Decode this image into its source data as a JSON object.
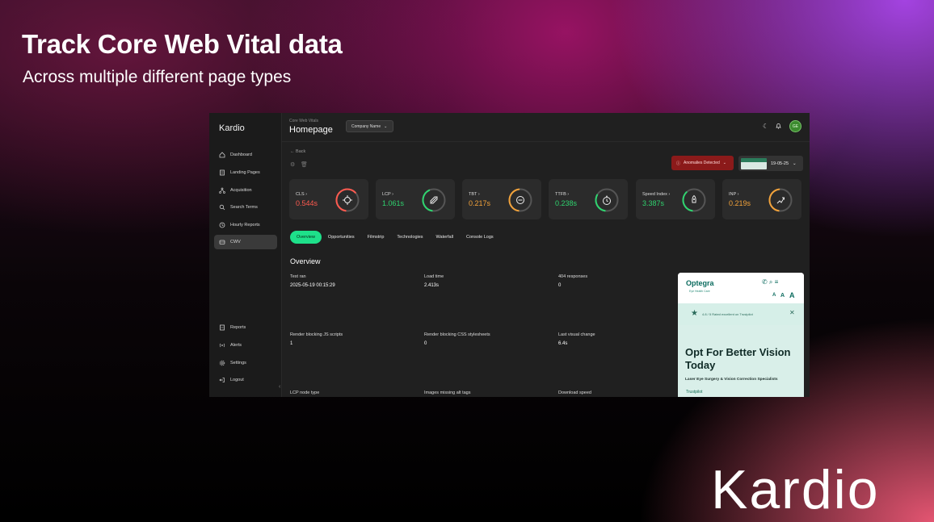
{
  "hero": {
    "title": "Track Core Web Vital data",
    "subtitle": "Across multiple different page types",
    "brand": "Kardio"
  },
  "app": {
    "logo": "Kardio",
    "sidebar": {
      "items": [
        {
          "label": "Dashboard",
          "icon": "home-icon"
        },
        {
          "label": "Landing Pages",
          "icon": "page-icon"
        },
        {
          "label": "Acquisition",
          "icon": "network-icon"
        },
        {
          "label": "Search Terms",
          "icon": "search-icon"
        },
        {
          "label": "Hourly Reports",
          "icon": "clock-icon"
        },
        {
          "label": "CWV",
          "icon": "gauge-icon",
          "active": true
        }
      ],
      "bottom_items": [
        {
          "label": "Reports",
          "icon": "report-icon"
        },
        {
          "label": "Alerts",
          "icon": "broadcast-icon"
        },
        {
          "label": "Settings",
          "icon": "gear-icon"
        },
        {
          "label": "Logout",
          "icon": "logout-icon"
        }
      ]
    },
    "header": {
      "breadcrumb": "Core Web Vitals",
      "title": "Homepage",
      "company_select": "Company Name",
      "avatar_initials": "GE"
    },
    "toolbar": {
      "back_label": "← Back",
      "anomalies_label": "Anomalies Detected",
      "date": "19-05-25"
    },
    "metrics": [
      {
        "label": "CLS",
        "value": "0.544s",
        "color": "#ff5a4f",
        "ring": "#ff5a4f",
        "fill": 0.6,
        "icon": "crosshair-icon"
      },
      {
        "label": "LCP",
        "value": "1.061s",
        "color": "#2fd46f",
        "ring": "#2fd46f",
        "fill": 0.4,
        "icon": "rocket-icon"
      },
      {
        "label": "TBT",
        "value": "0.217s",
        "color": "#f2a23a",
        "ring": "#f2a23a",
        "fill": 0.45,
        "icon": "blocked-icon"
      },
      {
        "label": "TTFB",
        "value": "0.238s",
        "color": "#2fd46f",
        "ring": "#2fd46f",
        "fill": 0.3,
        "icon": "timer-icon"
      },
      {
        "label": "Speed Index",
        "value": "3.387s",
        "color": "#2fd46f",
        "ring": "#2fd46f",
        "fill": 0.35,
        "icon": "rocket-launch-icon"
      },
      {
        "label": "INP",
        "value": "0.219s",
        "color": "#f2a23a",
        "ring": "#f2a23a",
        "fill": 0.45,
        "icon": "pointer-icon"
      }
    ],
    "tabs": [
      "Overview",
      "Opportunities",
      "Filmstrip",
      "Technologies",
      "Waterfall",
      "Console Logs"
    ],
    "overview": {
      "title": "Overview",
      "fields": [
        {
          "label": "Test ran",
          "value": "2025-05-19 00:15:29"
        },
        {
          "label": "Load time",
          "value": "2.413s"
        },
        {
          "label": "404 responses",
          "value": "0"
        },
        {
          "label": "Render blocking JS scripts",
          "value": "1"
        },
        {
          "label": "Render blocking CSS stylesheets",
          "value": "0"
        },
        {
          "label": "Last visual change",
          "value": "6.4s"
        },
        {
          "label": "LCP node type",
          "value": ""
        },
        {
          "label": "Images missing alt tags",
          "value": ""
        },
        {
          "label": "Download speed",
          "value": ""
        }
      ]
    },
    "preview": {
      "logo": "Optegra",
      "logo_sub": "Eye Health Care",
      "rating": "4.8 / 5 Rated excellent on Trustpilot",
      "headline": "Opt For Better Vision Today",
      "tagline": "Laser Eye Surgery & Vision Correction Specialists",
      "trust": "Trustpilot"
    }
  }
}
